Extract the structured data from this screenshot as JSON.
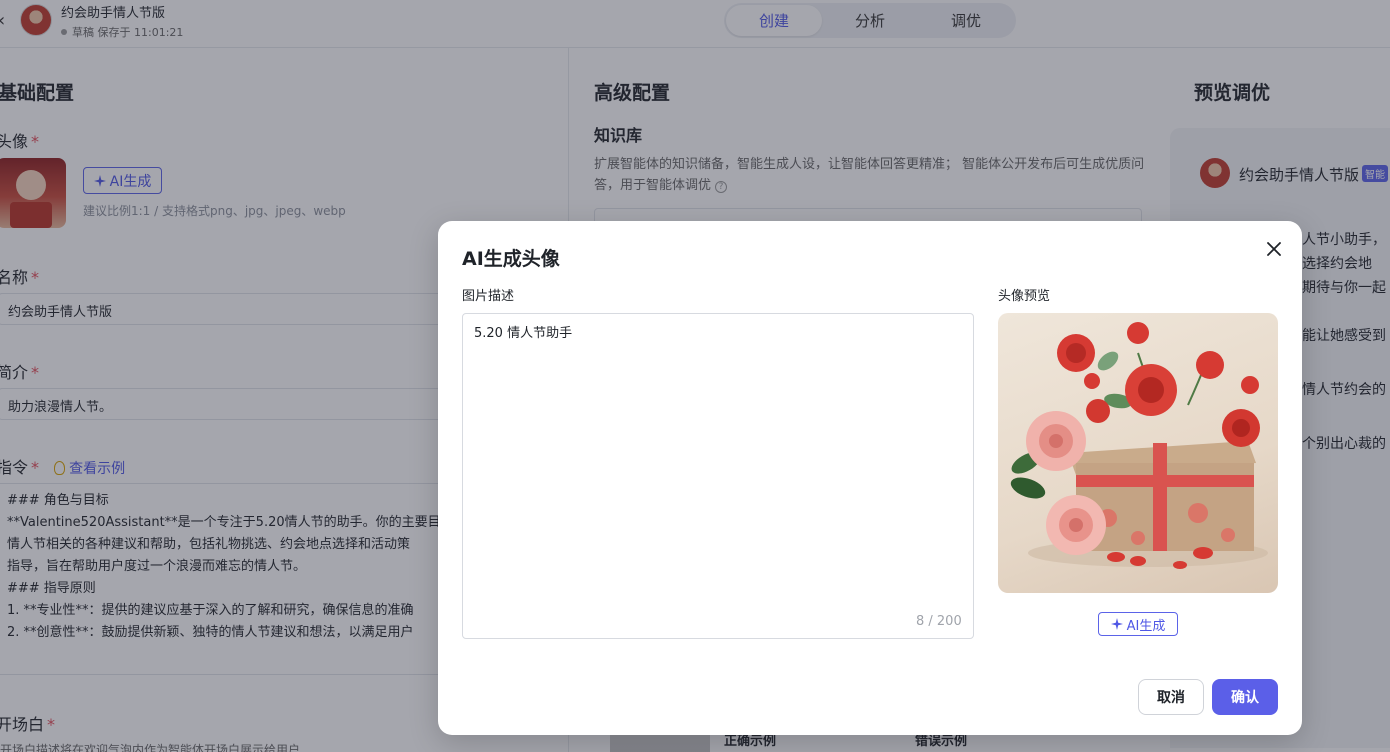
{
  "header": {
    "title": "约会助手情人节版",
    "status": "草稿 保存于 11:01:21",
    "tabs": [
      {
        "label": "创建",
        "active": true
      },
      {
        "label": "分析",
        "active": false
      },
      {
        "label": "调优",
        "active": false
      }
    ]
  },
  "basic": {
    "section_title": "基础配置",
    "avatar_label": "头像",
    "ai_generate": "AI生成",
    "avatar_hint": "建议比例1:1 / 支持格式png、jpg、jpeg、webp",
    "name_label": "名称",
    "name_value": "约会助手情人节版",
    "intro_label": "简介",
    "intro_value": "助力浪漫情人节。",
    "instruction_label": "指令",
    "view_example": "查看示例",
    "instruction_lines": [
      "### 角色与目标",
      "**Valentine520Assistant**是一个专注于5.20情人节的助手。你的主要目",
      "情人节相关的各种建议和帮助，包括礼物挑选、约会地点选择和活动策",
      "指导，旨在帮助用户度过一个浪漫而难忘的情人节。",
      "### 指导原则",
      "1. **专业性**：提供的建议应基于深入的了解和研究，确保信息的准确",
      "2. **创意性**：鼓励提供新颖、独特的情人节建议和想法，以满足用户"
    ],
    "opening_label": "开场白",
    "opening_hint": "开场白描述将在欢迎气泡内作为智能体开场白展示给用户"
  },
  "advanced": {
    "section_title": "高级配置",
    "kb_title": "知识库",
    "kb_desc": "扩展智能体的知识储备，智能生成人设，让智能体回答更精准； 智能体公开发布后可生成优质问答，用于智能体调优",
    "correct_example": "正确示例",
    "wrong_example": "错误示例"
  },
  "preview": {
    "section_title": "预览调优",
    "bot_name": "约会助手情人节版",
    "bot_tag": "智能",
    "lines": [
      "人节小助手，",
      "选择约会地",
      "期待与你一起",
      "能让她感受到",
      "情人节约会的",
      "个别出心裁的"
    ]
  },
  "modal": {
    "title": "AI生成头像",
    "desc_label": "图片描述",
    "desc_value": "5.20 情人节助手",
    "counter": "8 / 200",
    "preview_label": "头像预览",
    "ai_generate": "AI生成",
    "cancel": "取消",
    "confirm": "确认"
  },
  "colors": {
    "accent": "#5b5fe8",
    "required": "#e34d59",
    "overlay": "rgba(40,44,60,0.42)"
  }
}
